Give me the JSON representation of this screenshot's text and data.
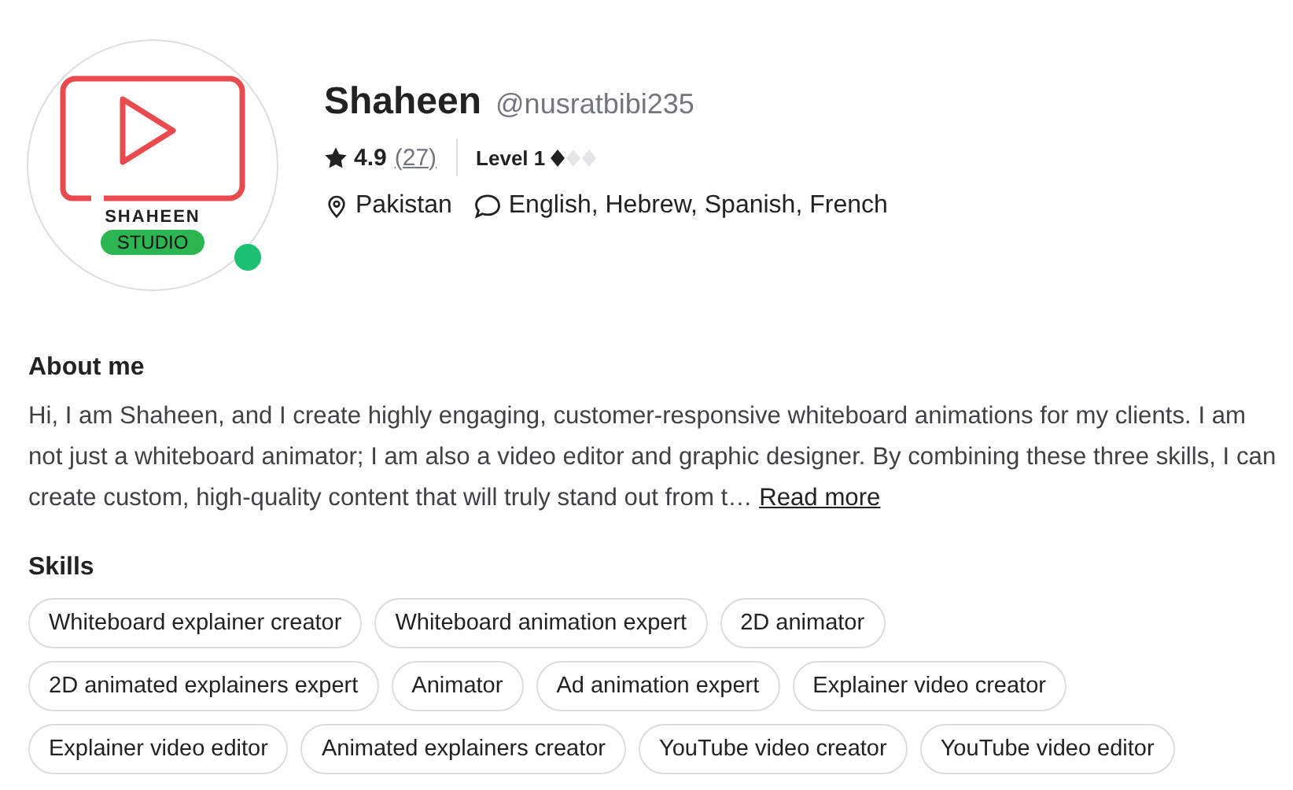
{
  "profile": {
    "avatar": {
      "brand": "SHAHEEN",
      "badge": "STUDIO",
      "online": true
    },
    "name": "Shaheen",
    "username": "@nusratbibi235",
    "rating": "4.9",
    "reviews": "(27)",
    "level": "Level 1",
    "level_diamonds": [
      {
        "filled": true
      },
      {
        "filled": false
      },
      {
        "filled": false
      }
    ],
    "location": "Pakistan",
    "languages": "English, Hebrew, Spanish, French"
  },
  "about": {
    "heading": "About me",
    "text": "Hi, I am Shaheen, and I create highly engaging, customer-responsive whiteboard animations for my clients. I am not just a whiteboard animator; I am also a video editor and graphic designer. By combining these three skills, I can create custom, high-quality content that will truly stand out from t…",
    "link": "Read more"
  },
  "skills": {
    "heading": "Skills",
    "rows": [
      [
        "Whiteboard explainer creator",
        "Whiteboard animation expert",
        "2D animator"
      ],
      [
        "2D animated explainers expert",
        "Animator",
        "Ad animation expert",
        "Explainer video creator"
      ],
      [
        "Explainer video editor",
        "Animated explainers creator",
        "YouTube video creator",
        "YouTube video editor"
      ]
    ]
  }
}
